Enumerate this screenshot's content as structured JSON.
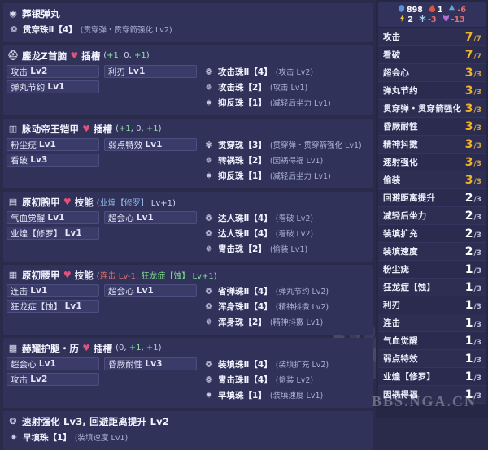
{
  "colors": {
    "bg": "#2a2b4a",
    "card": "#31325a",
    "skillbox": "#3a3b68",
    "accent_gold": "#f0b429",
    "slot_marker": "#e0527a",
    "panel": "#262744"
  },
  "watermark": {
    "paw": "paw-print-watermark",
    "big_text": "NGA",
    "url": "BBS.NGA.CN"
  },
  "left": {
    "cards": [
      {
        "type": "weapon",
        "icon": "weapon-icon",
        "name": "葬银弹丸",
        "decos": [
          {
            "icon": "deco-lv4-icon",
            "name": "贯穿珠Ⅱ【4】",
            "effect": "(贯穿弹・贯穿箭强化 Lv2)"
          }
        ]
      },
      {
        "type": "armor",
        "icon": "helmet-icon",
        "name": "鏖龙Z首脑",
        "slot_label": "插槽",
        "slots": "(+1, 0, +1)",
        "slot_values": [
          "+1",
          "0",
          "+1"
        ],
        "skills": [
          {
            "name": "攻击",
            "level": "Lv2"
          },
          {
            "name": "利刃",
            "level": "Lv1"
          },
          {
            "name": "弹丸节约",
            "level": "Lv1"
          },
          {
            "name": "",
            "level": ""
          }
        ],
        "decos": [
          {
            "icon": "deco-lv4-icon",
            "name": "攻击珠Ⅱ【4】",
            "effect": "(攻击 Lv2)"
          },
          {
            "icon": "deco-lv2-icon",
            "name": "攻击珠【2】",
            "effect": "(攻击 Lv1)"
          },
          {
            "icon": "deco-lv1-icon",
            "name": "抑反珠【1】",
            "effect": "(减轻后坐力 Lv1)"
          }
        ]
      },
      {
        "type": "armor",
        "icon": "chest-icon",
        "name": "脉动帝王铠甲",
        "slot_label": "插槽",
        "slots": "(+1, 0, +1)",
        "slot_values": [
          "+1",
          "0",
          "+1"
        ],
        "skills": [
          {
            "name": "粉尘疣",
            "level": "Lv1"
          },
          {
            "name": "弱点特效",
            "level": "Lv1"
          },
          {
            "name": "看破",
            "level": "Lv3"
          },
          {
            "name": "",
            "level": ""
          }
        ],
        "decos": [
          {
            "icon": "deco-lv3-icon",
            "name": "贯穿珠【3】",
            "effect": "(贯穿弹・贯穿箭强化 Lv1)"
          },
          {
            "icon": "deco-lv2-icon",
            "name": "转祸珠【2】",
            "effect": "(因祸得福 Lv1)"
          },
          {
            "icon": "deco-lv1-icon",
            "name": "抑反珠【1】",
            "effect": "(减轻后坐力 Lv1)"
          }
        ]
      },
      {
        "type": "armor",
        "icon": "arms-icon",
        "name": "原初腕甲",
        "slot_label": "技能",
        "slots": "(业煌【修罗】 Lv+1)",
        "slots_skill": "业煌【修罗】",
        "slots_skill_lv": "Lv+1",
        "skills": [
          {
            "name": "气血觉醒",
            "level": "Lv1"
          },
          {
            "name": "超会心",
            "level": "Lv1"
          },
          {
            "name": "业煌【修罗】",
            "level": "Lv1"
          },
          {
            "name": "",
            "level": ""
          }
        ],
        "decos": [
          {
            "icon": "deco-lv4-icon",
            "name": "达人珠Ⅱ【4】",
            "effect": "(看破 Lv2)"
          },
          {
            "icon": "deco-lv4-icon",
            "name": "达人珠Ⅱ【4】",
            "effect": "(看破 Lv2)"
          },
          {
            "icon": "deco-lv2-icon",
            "name": "冑击珠【2】",
            "effect": "(偷装 Lv1)"
          }
        ]
      },
      {
        "type": "armor",
        "icon": "waist-icon",
        "name": "原初腰甲",
        "slot_label": "技能",
        "slots": "(连击 Lv-1, 狂龙症【蚀】 Lv+1)",
        "slots_skill_a": "连击 Lv-1",
        "slots_skill_b": "狂龙症【蚀】 Lv+1",
        "skills": [
          {
            "name": "连击",
            "level": "Lv1"
          },
          {
            "name": "超会心",
            "level": "Lv1"
          },
          {
            "name": "狂龙症【蚀】",
            "level": "Lv1"
          },
          {
            "name": "",
            "level": ""
          }
        ],
        "decos": [
          {
            "icon": "deco-lv4-icon",
            "name": "省弹珠Ⅱ【4】",
            "effect": "(弹丸节约 Lv2)"
          },
          {
            "icon": "deco-lv4-icon",
            "name": "浑身珠Ⅱ【4】",
            "effect": "(精神抖擞 Lv2)"
          },
          {
            "icon": "deco-lv2-icon",
            "name": "浑身珠【2】",
            "effect": "(精神抖擞 Lv1)"
          }
        ]
      },
      {
        "type": "armor",
        "icon": "legs-icon",
        "name": "赫耀护腿・历",
        "slot_label": "插槽",
        "slots": "(0, +1, +1)",
        "slot_values": [
          "0",
          "+1",
          "+1"
        ],
        "skills": [
          {
            "name": "超会心",
            "level": "Lv1"
          },
          {
            "name": "昏厥耐性",
            "level": "Lv3"
          },
          {
            "name": "攻击",
            "level": "Lv2"
          },
          {
            "name": "",
            "level": ""
          }
        ],
        "decos": [
          {
            "icon": "deco-lv4-icon",
            "name": "装填珠Ⅱ【4】",
            "effect": "(装填扩充 Lv2)"
          },
          {
            "icon": "deco-lv4-icon",
            "name": "冑击珠Ⅱ【4】",
            "effect": "(偷装 Lv2)"
          },
          {
            "icon": "deco-lv1-icon",
            "name": "早填珠【1】",
            "effect": "(装填速度 Lv1)"
          }
        ]
      },
      {
        "type": "charm",
        "icon": "charm-icon",
        "name": "速射强化 Lv3, 回避距离提升 Lv2",
        "decos": [
          {
            "icon": "deco-lv1-icon",
            "name": "早填珠【1】",
            "effect": "(装填速度 Lv1)"
          }
        ]
      }
    ]
  },
  "right": {
    "resistances": [
      {
        "icon": "defense-icon",
        "label": "defense",
        "value": "898",
        "color": "#ffffff"
      },
      {
        "icon": "fire-icon",
        "label": "fire",
        "value": "1",
        "color": "#ffffff"
      },
      {
        "icon": "water-icon",
        "label": "water",
        "value": "-6",
        "color": "#e0716e"
      },
      {
        "icon": "thunder-icon",
        "label": "thunder",
        "value": "2",
        "color": "#ffffff"
      },
      {
        "icon": "ice-icon",
        "label": "ice",
        "value": "-3",
        "color": "#e0716e"
      },
      {
        "icon": "dragon-icon",
        "label": "dragon",
        "value": "-13",
        "color": "#e0716e"
      }
    ],
    "skills": [
      {
        "name": "攻击",
        "cur": "7",
        "max": "7",
        "maxed": true
      },
      {
        "name": "看破",
        "cur": "7",
        "max": "7",
        "maxed": true
      },
      {
        "name": "超会心",
        "cur": "3",
        "max": "3",
        "maxed": true
      },
      {
        "name": "弹丸节约",
        "cur": "3",
        "max": "3",
        "maxed": true
      },
      {
        "name": "贯穿弹・贯穿箭强化",
        "cur": "3",
        "max": "3",
        "maxed": true
      },
      {
        "name": "昏厥耐性",
        "cur": "3",
        "max": "3",
        "maxed": true
      },
      {
        "name": "精神抖擞",
        "cur": "3",
        "max": "3",
        "maxed": true
      },
      {
        "name": "速射强化",
        "cur": "3",
        "max": "3",
        "maxed": true
      },
      {
        "name": "偷装",
        "cur": "3",
        "max": "3",
        "maxed": true
      },
      {
        "name": "回避距离提升",
        "cur": "2",
        "max": "3",
        "maxed": false
      },
      {
        "name": "减轻后坐力",
        "cur": "2",
        "max": "3",
        "maxed": false
      },
      {
        "name": "装填扩充",
        "cur": "2",
        "max": "3",
        "maxed": false
      },
      {
        "name": "装填速度",
        "cur": "2",
        "max": "3",
        "maxed": false
      },
      {
        "name": "粉尘疣",
        "cur": "1",
        "max": "3",
        "maxed": false
      },
      {
        "name": "狂龙症【蚀】",
        "cur": "1",
        "max": "3",
        "maxed": false
      },
      {
        "name": "利刃",
        "cur": "1",
        "max": "3",
        "maxed": false
      },
      {
        "name": "连击",
        "cur": "1",
        "max": "3",
        "maxed": false
      },
      {
        "name": "气血觉醒",
        "cur": "1",
        "max": "3",
        "maxed": false
      },
      {
        "name": "弱点特效",
        "cur": "1",
        "max": "3",
        "maxed": false
      },
      {
        "name": "业煌【修罗】",
        "cur": "1",
        "max": "3",
        "maxed": false
      },
      {
        "name": "因祸得福",
        "cur": "1",
        "max": "3",
        "maxed": false
      }
    ]
  }
}
